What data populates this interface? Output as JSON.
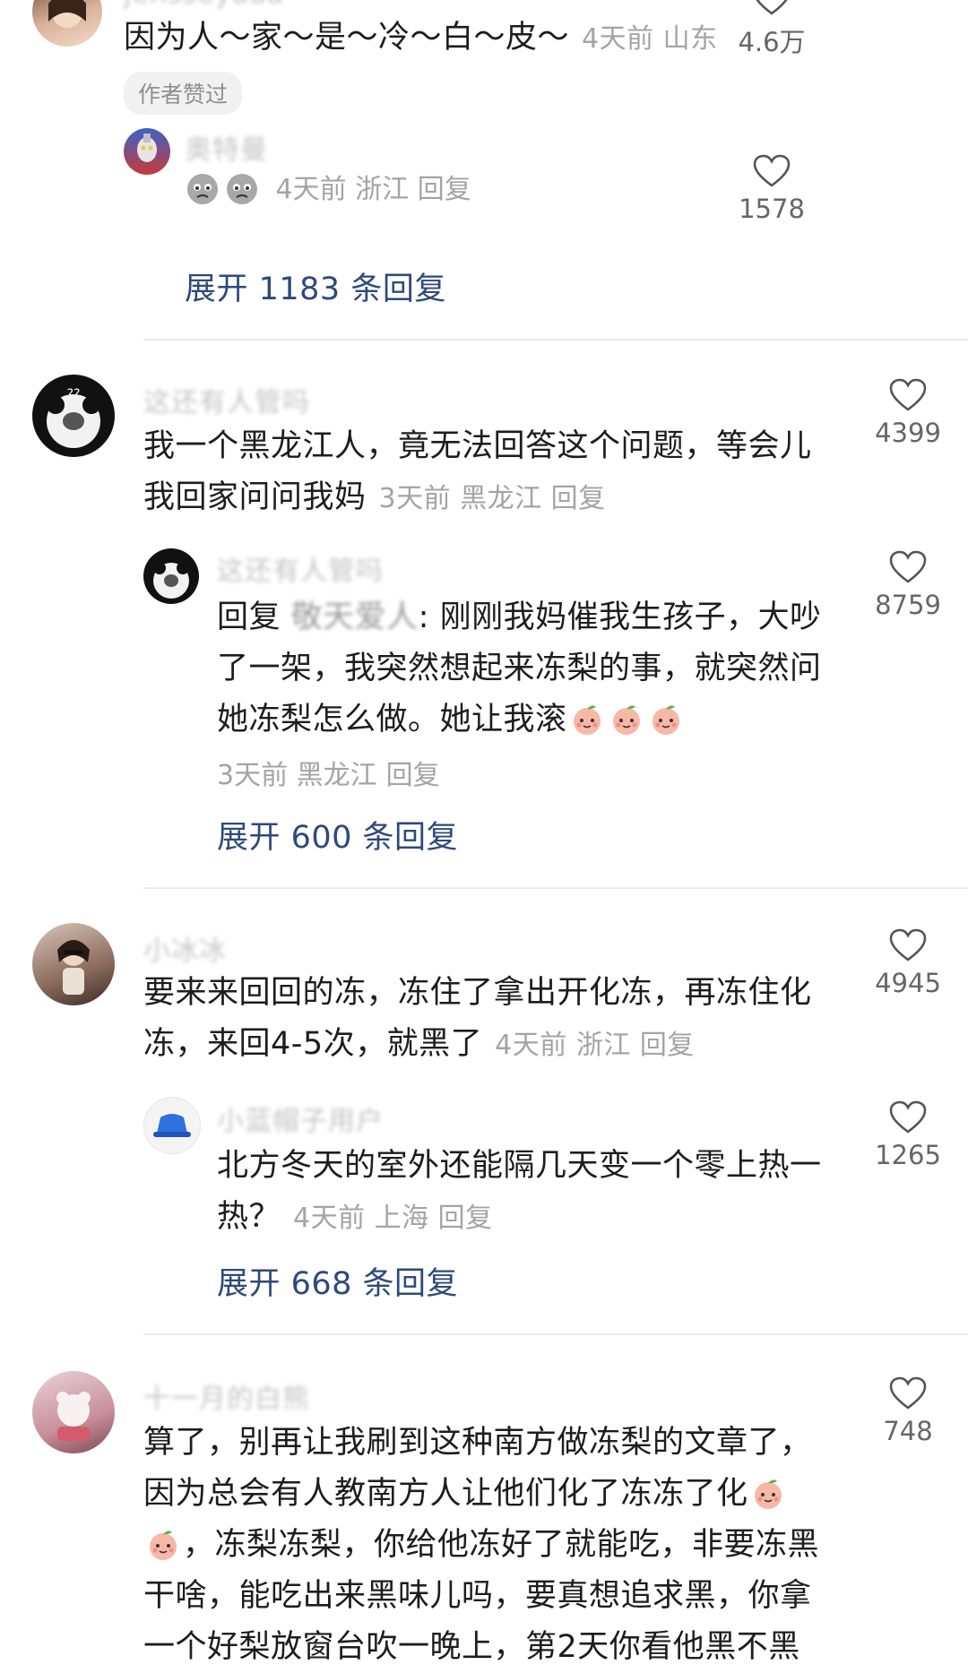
{
  "comments": [
    {
      "user": "jensseyuaa",
      "text": "因为人～家～是～冷～白～皮～",
      "time": "4天前",
      "location": "山东",
      "reply_label": "回复",
      "likes": "4.6万",
      "badge": "作者赞过"
    },
    {
      "user": "奥特曼",
      "text": "",
      "time": "4天前",
      "location": "浙江",
      "reply_label": "回复",
      "likes": "1578",
      "expand": "展开 1183 条回复"
    },
    {
      "user": "这还有人管吗",
      "text_line1": "我一个黑龙江人，竟无法回答这个问题，等会儿",
      "text_line2": "我回家问问我妈",
      "time": "3天前",
      "location": "黑龙江",
      "reply_label": "回复",
      "likes": "4399"
    },
    {
      "user": "这还有人管吗",
      "reply_prefix": "回复",
      "reply_target": "敬天爱人",
      "text_line1": ": 刚刚我妈催我生孩子，大吵",
      "text_line2": "了一架，我突然想起来冻梨的事，就突然问",
      "text_line3": "她冻梨怎么做。她让我滚",
      "time": "3天前",
      "location": "黑龙江",
      "reply_label": "回复",
      "likes": "8759",
      "expand": "展开 600 条回复"
    },
    {
      "user": "小冰冰",
      "text_line1": "要来来回回的冻，冻住了拿出开化冻，再冻住化",
      "text_line2": "冻，来回4-5次，就黑了",
      "time": "4天前",
      "location": "浙江",
      "reply_label": "回复",
      "likes": "4945"
    },
    {
      "user": "小蓝帽子用户",
      "text_line1": "北方冬天的室外还能隔几天变一个零上热一",
      "text_line2": "热？",
      "time": "4天前",
      "location": "上海",
      "reply_label": "回复",
      "likes": "1265",
      "expand": "展开 668 条回复"
    },
    {
      "user": "十一月的白熊",
      "text_line1": "算了，别再让我刷到这种南方做冻梨的文章了，",
      "text_line2": "因为总会有人教南方人让他们化了冻冻了化",
      "text_line3": "，冻梨冻梨，你给他冻好了就能吃，非要冻黑",
      "text_line4": "干啥，能吃出来黑味儿吗，要真想追求黑，你拿",
      "text_line5": "一个好梨放窗台吹一晚上，第2天你看他黑不黑",
      "likes": "748"
    }
  ],
  "colors": {
    "link": "#2e4a7a",
    "meta": "#a4a4a4",
    "text": "#1d1d1d",
    "divider": "#ececec"
  }
}
